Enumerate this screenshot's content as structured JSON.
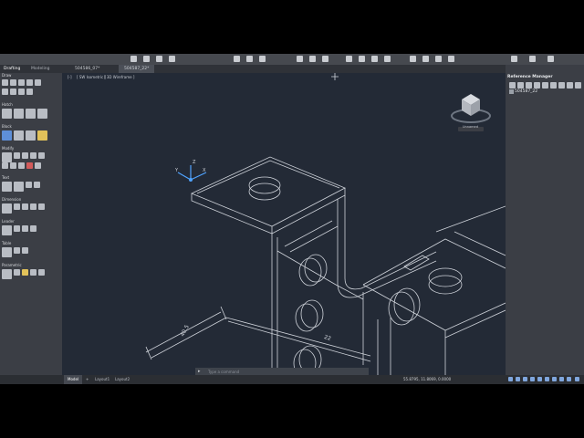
{
  "app": {
    "workspace_tabs": [
      {
        "label": "Drafting",
        "active": true
      },
      {
        "label": "Modeling",
        "active": false
      }
    ],
    "document_tabs": [
      {
        "label": "504586_07*",
        "active": false
      },
      {
        "label": "504587_22*",
        "active": true
      }
    ],
    "viewport_labels": [
      "[-]",
      "[ SW Isometric ]",
      "[ 3D Wireframe ]"
    ],
    "panel_sections": [
      {
        "title": "Draw"
      },
      {
        "title": "Hatch"
      },
      {
        "title": "Block"
      },
      {
        "title": "Modify"
      },
      {
        "title": "Text"
      },
      {
        "title": "Dimension"
      },
      {
        "title": "Leader"
      },
      {
        "title": "Table"
      },
      {
        "title": "Parametric"
      }
    ]
  },
  "drawing": {
    "dimension_1": "40.5",
    "dimension_2": "22",
    "viewcube_label": "Unnamed",
    "ucs_x": "X",
    "ucs_y": "Y",
    "ucs_z": "Z"
  },
  "reference_manager": {
    "title": "Reference Manager",
    "items": [
      "504587_22"
    ]
  },
  "status": {
    "layout_tabs": [
      {
        "label": "Model",
        "active": true
      },
      {
        "label": "+",
        "active": false
      },
      {
        "label": "Layout1",
        "active": false
      },
      {
        "label": "Layout2",
        "active": false
      }
    ],
    "coordinates": "55.8795, 11.8069, 0.0000",
    "command_placeholder": "Type a command"
  }
}
